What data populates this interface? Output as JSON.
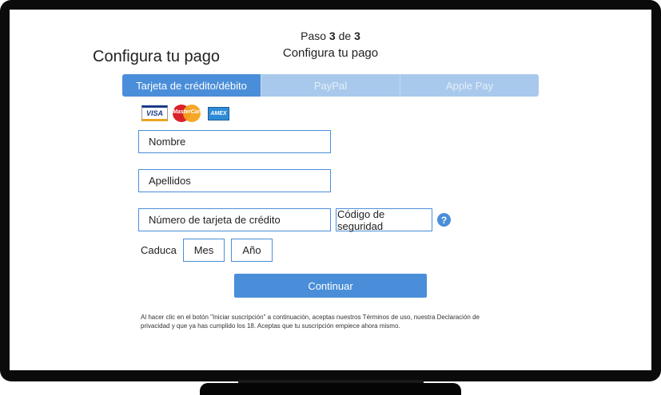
{
  "header": {
    "step_prefix": "Paso",
    "step_current": "3",
    "step_of": "de",
    "step_total": "3",
    "subtitle": "Configura tu pago",
    "title": "Configura tu pago"
  },
  "tabs": [
    {
      "label": "Tarjeta de crédito/débito",
      "active": true
    },
    {
      "label": "PayPal",
      "active": false
    },
    {
      "label": "Apple Pay",
      "active": false
    }
  ],
  "card_logos": {
    "visa": "VISA",
    "mastercard": "MasterCard",
    "amex": "AMEX"
  },
  "form": {
    "first_name_placeholder": "Nombre",
    "last_name_placeholder": "Apellidos",
    "card_number_placeholder": "Número de tarjeta de crédito",
    "security_code_placeholder": "Código de seguridad",
    "help_icon": "?",
    "expiry_label": "Caduca",
    "month_label": "Mes",
    "year_label": "Año"
  },
  "actions": {
    "continue_label": "Continuar"
  },
  "legal": {
    "text": "Al hacer clic en el botón \"Iniciar suscripción\" a continuación, aceptas nuestros Términos de uso, nuestra Declaración de privacidad y que ya has cumplido los 18. Aceptas que tu suscripción empiece ahora mismo."
  },
  "colors": {
    "accent": "#4a8ed9",
    "tab_inactive": "#a9c9ec",
    "bezel": "#0b0b0b"
  }
}
